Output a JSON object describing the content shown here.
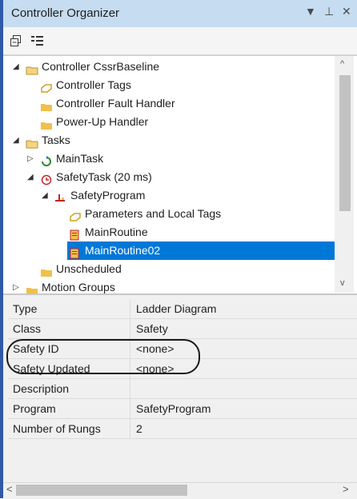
{
  "window": {
    "title": "Controller Organizer",
    "buttons": [
      "▼",
      "⊥",
      "✕"
    ]
  },
  "toolbar": {
    "icons": [
      "collapse-all-icon",
      "properties-view-icon"
    ]
  },
  "tree": [
    {
      "label": "Controller CssrBaseline",
      "icon": "open-folder-icon",
      "toggle": "◢"
    },
    {
      "label": "Controller Tags",
      "icon": "tag-icon"
    },
    {
      "label": "Controller Fault Handler",
      "icon": "folder-icon"
    },
    {
      "label": "Power-Up Handler",
      "icon": "folder-icon"
    },
    {
      "label": "Tasks",
      "icon": "open-folder-icon",
      "toggle": "◢"
    },
    {
      "label": "MainTask",
      "icon": "continuous-task-icon",
      "toggle": "▷"
    },
    {
      "label": "SafetyTask (20 ms)",
      "icon": "periodic-task-icon",
      "toggle": "◢"
    },
    {
      "label": "SafetyProgram",
      "icon": "safety-program-icon",
      "toggle": "◢"
    },
    {
      "label": "Parameters and Local Tags",
      "icon": "tag-icon"
    },
    {
      "label": "MainRoutine",
      "icon": "routine-icon"
    },
    {
      "label": "MainRoutine02",
      "icon": "routine-icon",
      "selected": true
    },
    {
      "label": "Unscheduled",
      "icon": "folder-icon"
    },
    {
      "label": "Motion Groups",
      "icon": "folder-icon",
      "toggle": "▷"
    }
  ],
  "properties": [
    {
      "name": "Type",
      "value": "Ladder Diagram"
    },
    {
      "name": "Class",
      "value": "Safety"
    },
    {
      "name": "Safety ID",
      "value": "<none>"
    },
    {
      "name": "Safety Updated",
      "value": "<none>"
    },
    {
      "name": "Description",
      "value": ""
    },
    {
      "name": "Program",
      "value": "SafetyProgram"
    },
    {
      "name": "Number of Rungs",
      "value": "2"
    }
  ],
  "colors": {
    "selection": "#0078d7",
    "titlebar": "#c6dcf0",
    "folder": "#f0c04a",
    "accent_strip": "#2e5aa8"
  }
}
